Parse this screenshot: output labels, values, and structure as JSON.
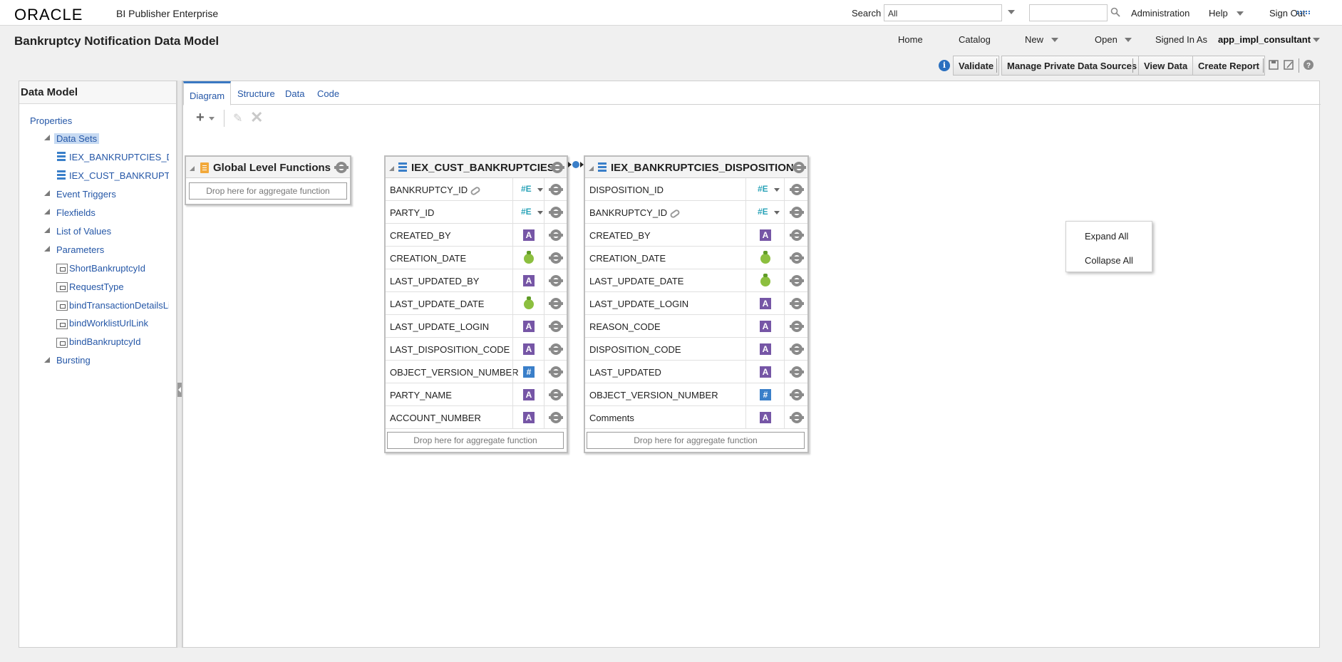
{
  "header": {
    "logo": "ORACLE",
    "product": "BI Publisher Enterprise",
    "search_label": "Search",
    "search_scope": "All",
    "search_value": "",
    "administration": "Administration",
    "help": "Help",
    "sign_out": "Sign Out"
  },
  "page": {
    "title": "Bankruptcy Notification Data Model",
    "nav": {
      "home": "Home",
      "catalog": "Catalog",
      "new": "New",
      "open": "Open",
      "signed_in_as": "Signed In As",
      "user": "app_impl_consultant"
    }
  },
  "toolbar": {
    "validate": "Validate",
    "manage_private": "Manage Private Data Sources",
    "view_data": "View Data",
    "create_report": "Create Report"
  },
  "left_panel": {
    "title": "Data Model",
    "properties": "Properties",
    "data_sets": "Data Sets",
    "datasets": [
      "IEX_BANKRUPTCIES_DIS",
      "IEX_CUST_BANKRUPTCI"
    ],
    "event_triggers": "Event Triggers",
    "flexfields": "Flexfields",
    "list_of_values": "List of Values",
    "parameters": "Parameters",
    "params": [
      "ShortBankruptcyId",
      "RequestType",
      "bindTransactionDetailsLin",
      "bindWorklistUrlLink",
      "bindBankruptcyId"
    ],
    "bursting": "Bursting"
  },
  "tabs": [
    "Diagram",
    "Structure",
    "Data",
    "Code"
  ],
  "diagram": {
    "global": {
      "title": "Global Level Functions",
      "drop": "Drop here for aggregate function"
    },
    "cust": {
      "title": "IEX_CUST_BANKRUPTCIES",
      "drop": "Drop here for aggregate function",
      "columns": [
        {
          "name": "BANKRUPTCY_ID",
          "type": "key",
          "link": true
        },
        {
          "name": "PARTY_ID",
          "type": "key"
        },
        {
          "name": "CREATED_BY",
          "type": "text"
        },
        {
          "name": "CREATION_DATE",
          "type": "date"
        },
        {
          "name": "LAST_UPDATED_BY",
          "type": "text"
        },
        {
          "name": "LAST_UPDATE_DATE",
          "type": "date"
        },
        {
          "name": "LAST_UPDATE_LOGIN",
          "type": "text"
        },
        {
          "name": "LAST_DISPOSITION_CODE",
          "type": "text"
        },
        {
          "name": "OBJECT_VERSION_NUMBER",
          "type": "number"
        },
        {
          "name": "PARTY_NAME",
          "type": "text"
        },
        {
          "name": "ACCOUNT_NUMBER",
          "type": "text"
        }
      ]
    },
    "disp": {
      "title": "IEX_BANKRUPTCIES_DISPOSITIONS",
      "drop": "Drop here for aggregate function",
      "columns": [
        {
          "name": "DISPOSITION_ID",
          "type": "key"
        },
        {
          "name": "BANKRUPTCY_ID",
          "type": "key",
          "link": true
        },
        {
          "name": "CREATED_BY",
          "type": "text"
        },
        {
          "name": "CREATION_DATE",
          "type": "date"
        },
        {
          "name": "LAST_UPDATE_DATE",
          "type": "date"
        },
        {
          "name": "LAST_UPDATE_LOGIN",
          "type": "text"
        },
        {
          "name": "REASON_CODE",
          "type": "text"
        },
        {
          "name": "DISPOSITION_CODE",
          "type": "text"
        },
        {
          "name": "LAST_UPDATED",
          "type": "text"
        },
        {
          "name": "OBJECT_VERSION_NUMBER",
          "type": "number"
        },
        {
          "name": "Comments",
          "type": "text"
        }
      ]
    }
  },
  "context_menu": {
    "expand_all": "Expand All",
    "collapse_all": "Collapse All"
  },
  "colors": {
    "link_blue": "#2557a7",
    "text_type": "#7656a6",
    "number_type": "#3a7fc9",
    "date_type": "#8cbf3f"
  }
}
